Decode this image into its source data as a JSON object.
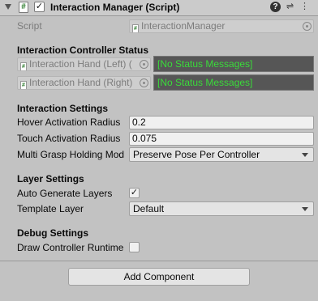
{
  "header": {
    "title": "Interaction Manager (Script)",
    "enabled_check": "✓",
    "script_glyph": "#",
    "help_glyph": "?",
    "settings_glyph": "⇌",
    "menu_glyph": "⋮"
  },
  "script_row": {
    "label": "Script",
    "value": "InteractionManager"
  },
  "controller_status": {
    "heading": "Interaction Controller Status",
    "rows": [
      {
        "object": "Interaction Hand (Left) (",
        "status": "[No Status Messages]"
      },
      {
        "object": "Interaction Hand (Right)",
        "status": "[No Status Messages]"
      }
    ]
  },
  "interaction_settings": {
    "heading": "Interaction Settings",
    "hover_label": "Hover Activation Radius",
    "hover_value": "0.2",
    "touch_label": "Touch Activation Radius",
    "touch_value": "0.075",
    "grasp_label": "Multi Grasp Holding Mod",
    "grasp_value": "Preserve Pose Per Controller"
  },
  "layer_settings": {
    "heading": "Layer Settings",
    "auto_label": "Auto Generate Layers",
    "auto_checked": "✓",
    "template_label": "Template Layer",
    "template_value": "Default"
  },
  "debug_settings": {
    "heading": "Debug Settings",
    "draw_label": "Draw Controller Runtime",
    "draw_checked": ""
  },
  "add_component_label": "Add Component",
  "colors": {
    "panel_bg": "#c2c2c2",
    "status_bg": "#565656",
    "status_text": "#3adb3a"
  }
}
